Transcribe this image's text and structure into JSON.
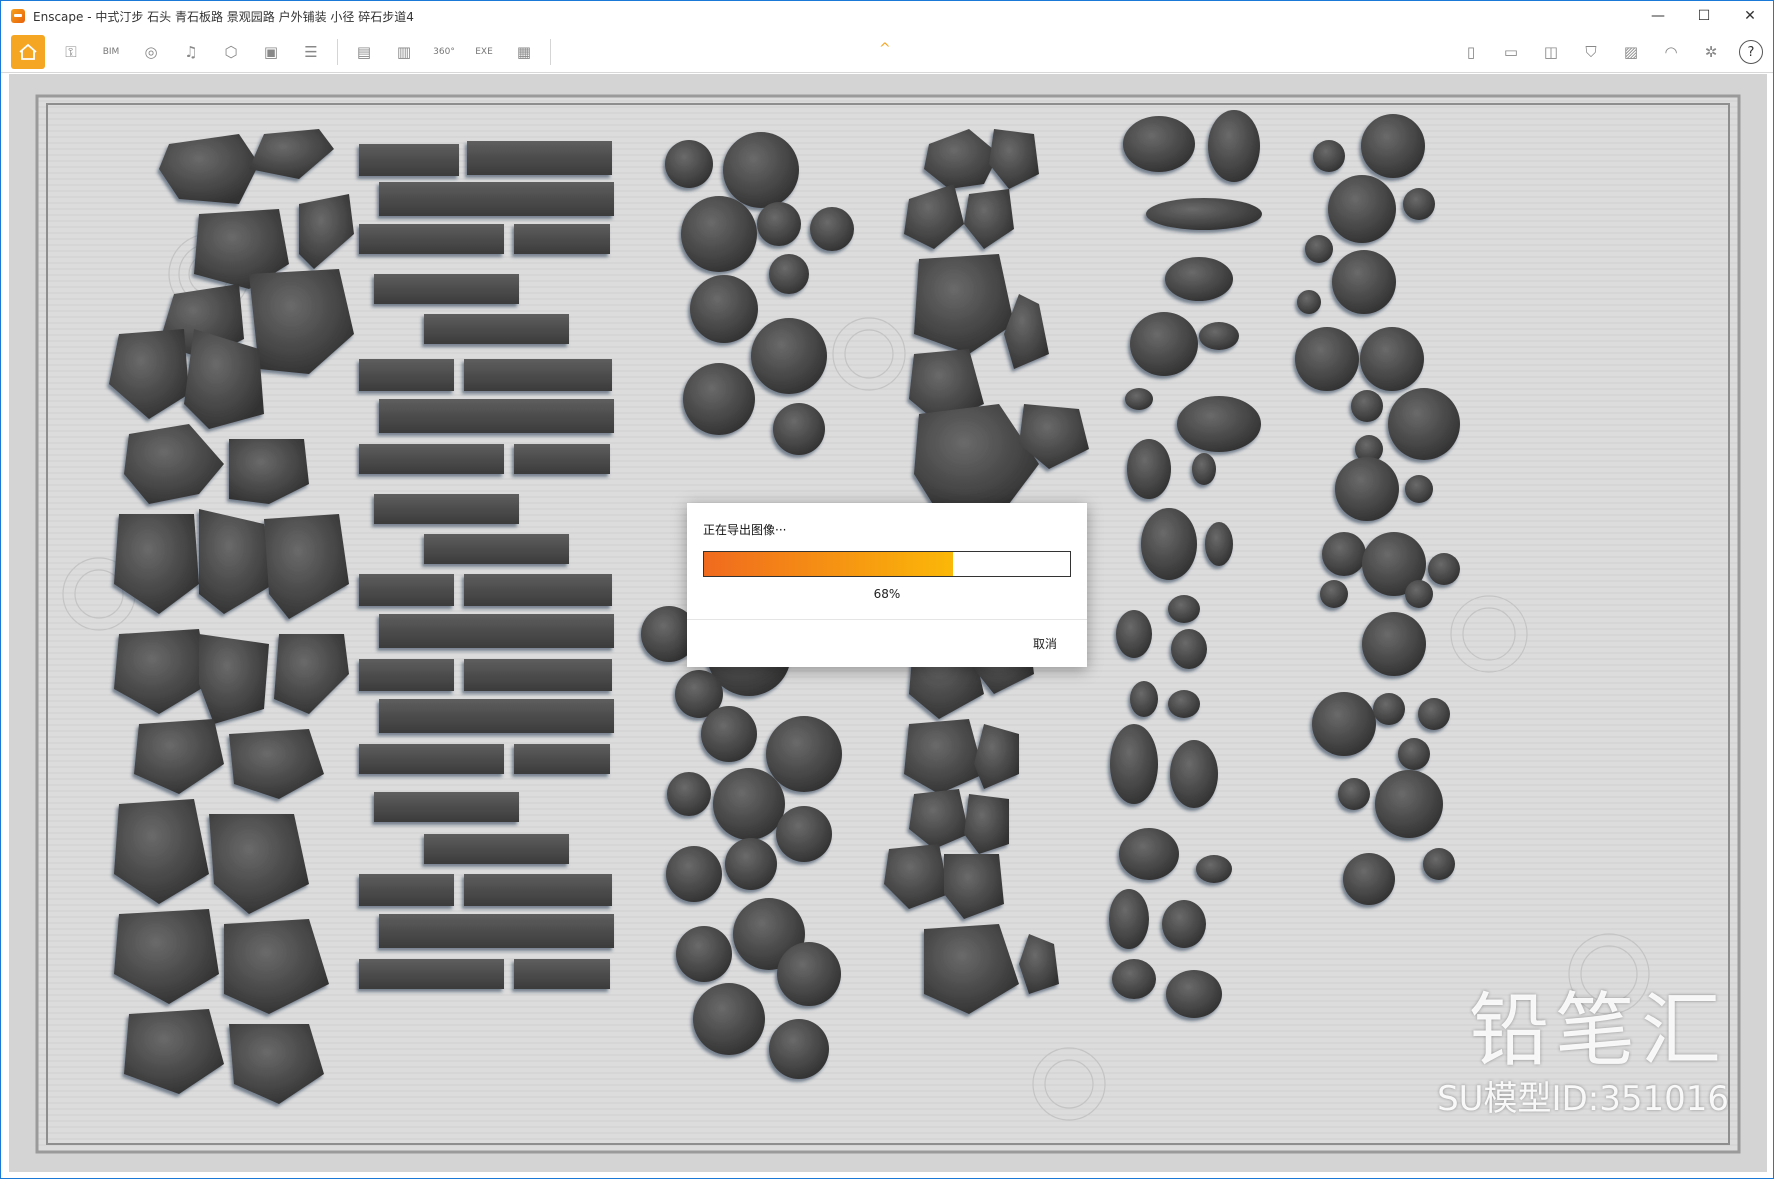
{
  "window": {
    "title": "Enscape - 中式汀步 石头 青石板路 景观园路 户外铺装 小径 碎石步道4",
    "controls": [
      "—",
      "☐",
      "✕"
    ]
  },
  "toolbar": {
    "bim_label": "BIM",
    "pano_label": "360°",
    "exe_label": "EXE",
    "collapse_glyph": "^",
    "help_glyph": "?",
    "accent_color": "#f5a623"
  },
  "watermark": {
    "brand": "铅笔汇",
    "model_id": "SU模型ID:351016"
  },
  "dialog": {
    "title": "正在导出图像···",
    "progress_percent": 68,
    "progress_label": "68%",
    "cancel_label": "取消",
    "gradient_start": "#f06a1e",
    "gradient_end": "#fbb808"
  }
}
